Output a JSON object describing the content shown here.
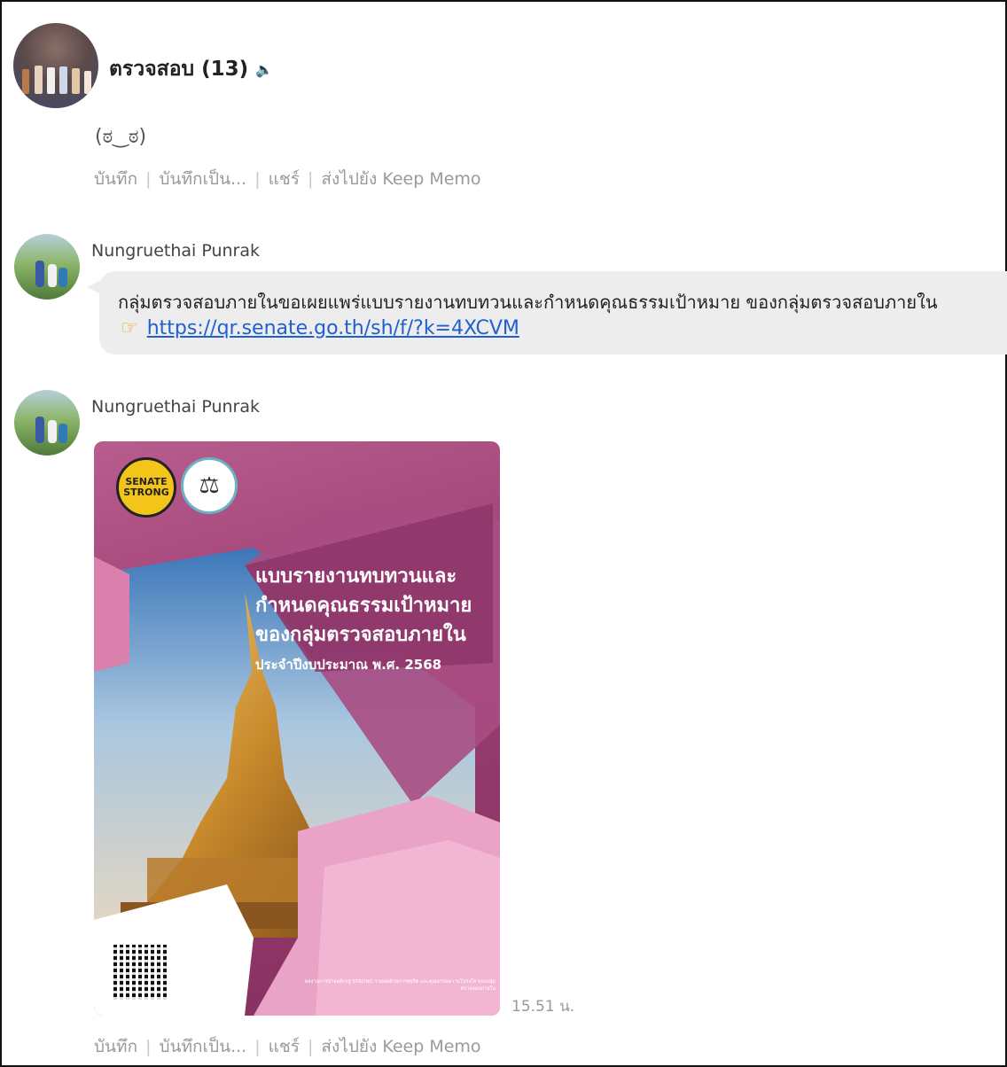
{
  "chat": {
    "title": "ตรวจสอบ (13)",
    "mute_icon": "speaker-muted-icon"
  },
  "messages": [
    {
      "sticker": "(ಠ‿ಠ)",
      "actions": [
        "บันทึก",
        "บันทึกเป็น...",
        "แชร์",
        "ส่งไปยัง Keep Memo"
      ]
    },
    {
      "sender": "Nungruethai Punrak",
      "text": "กลุ่มตรวจสอบภายในขอเผยแพร่แบบรายงานทบทวนและกำหนดคุณธรรมเป้าหมาย ของกลุ่มตรวจสอบภายใน",
      "link_icon": "pointing-hand-icon",
      "link": "https://qr.senate.go.th/sh/f/?k=4XCVM"
    },
    {
      "sender": "Nungruethai Punrak",
      "poster": {
        "logo_text": "SENATE STRONG",
        "title_lines": [
          "แบบรายงานทบทวนและ",
          "กำหนดคุณธรรมเป้าหมาย",
          "ของกลุ่มตรวจสอบภายใน"
        ],
        "subtitle": "ประจำปีงบประมาณ พ.ศ. 2568",
        "footer": "ผลงานการนำองค์กรสู่ STRONG ร่วมต่อต้านการทุจริต และคุณธรรมความโปร่งใส ของกลุ่มตรวจสอบภายใน"
      },
      "time": "15.51 น.",
      "actions": [
        "บันทึก",
        "บันทึกเป็น...",
        "แชร์",
        "ส่งไปยัง Keep Memo"
      ]
    }
  ],
  "colors": {
    "link": "#1f5fd1",
    "bubble": "#ededed",
    "poster_purple": "#9a3f73",
    "poster_pink": "#f2b6d3"
  }
}
